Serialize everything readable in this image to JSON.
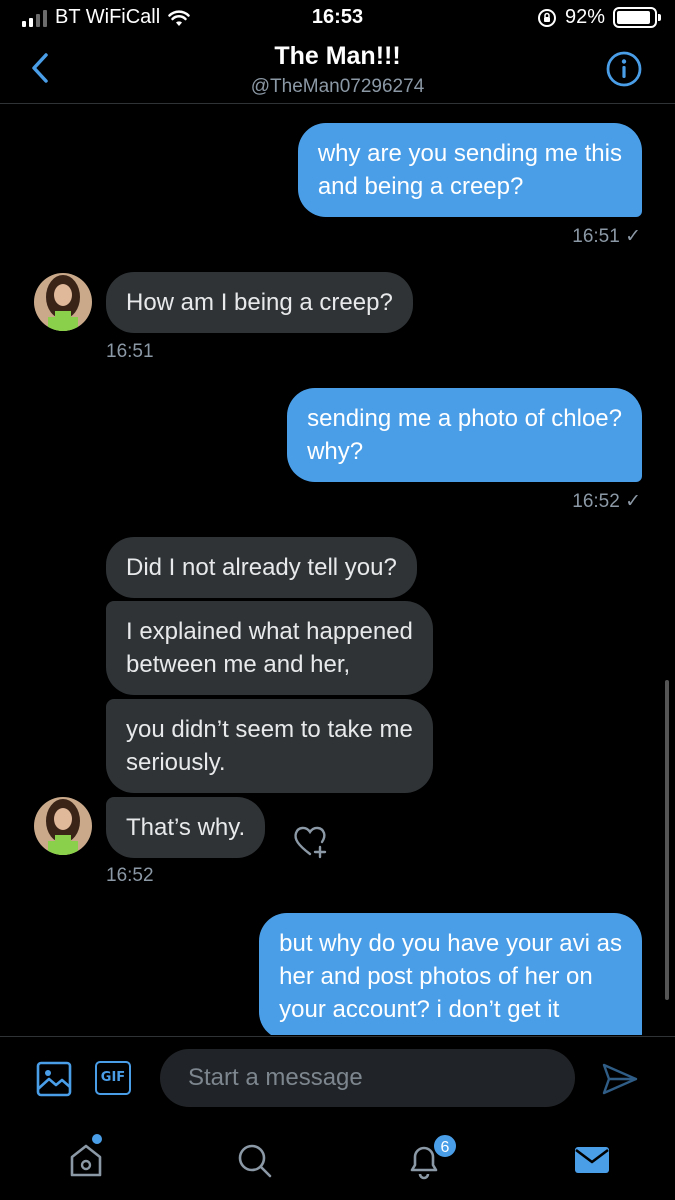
{
  "status_bar": {
    "carrier": "BT WiFiCall",
    "time": "16:53",
    "battery": "92%",
    "battery_level": 0.92
  },
  "header": {
    "name": "The Man!!!",
    "handle": "@TheMan07296274"
  },
  "messages": [
    {
      "direction": "out",
      "lines": [
        "why are you sending me this",
        "and being a creep?"
      ],
      "time": "16:51 ✓"
    },
    {
      "direction": "in",
      "lines": [
        "How am I being a creep?"
      ],
      "time": "16:51"
    },
    {
      "direction": "out",
      "lines": [
        "sending me a photo of chloe?",
        "why?"
      ],
      "time": "16:52 ✓"
    },
    {
      "direction": "in",
      "lines": [
        "Did I not already tell you?"
      ]
    },
    {
      "direction": "in",
      "lines": [
        "I explained what happened",
        "between me and her,"
      ]
    },
    {
      "direction": "in",
      "lines": [
        "you didn’t seem to take me",
        "seriously."
      ]
    },
    {
      "direction": "in",
      "lines": [
        "That’s why."
      ],
      "time": "16:52"
    },
    {
      "direction": "out",
      "lines": [
        "but why do you have your avi as",
        "her and post photos of her on",
        "your account? i don’t get it"
      ]
    }
  ],
  "composer": {
    "gif_label": "GIF",
    "placeholder": "Start a message"
  },
  "nav": {
    "notifications_badge": "6"
  },
  "colors": {
    "accent": "#4a9ee8",
    "incoming_bubble": "#2f3336",
    "background": "#000000"
  }
}
